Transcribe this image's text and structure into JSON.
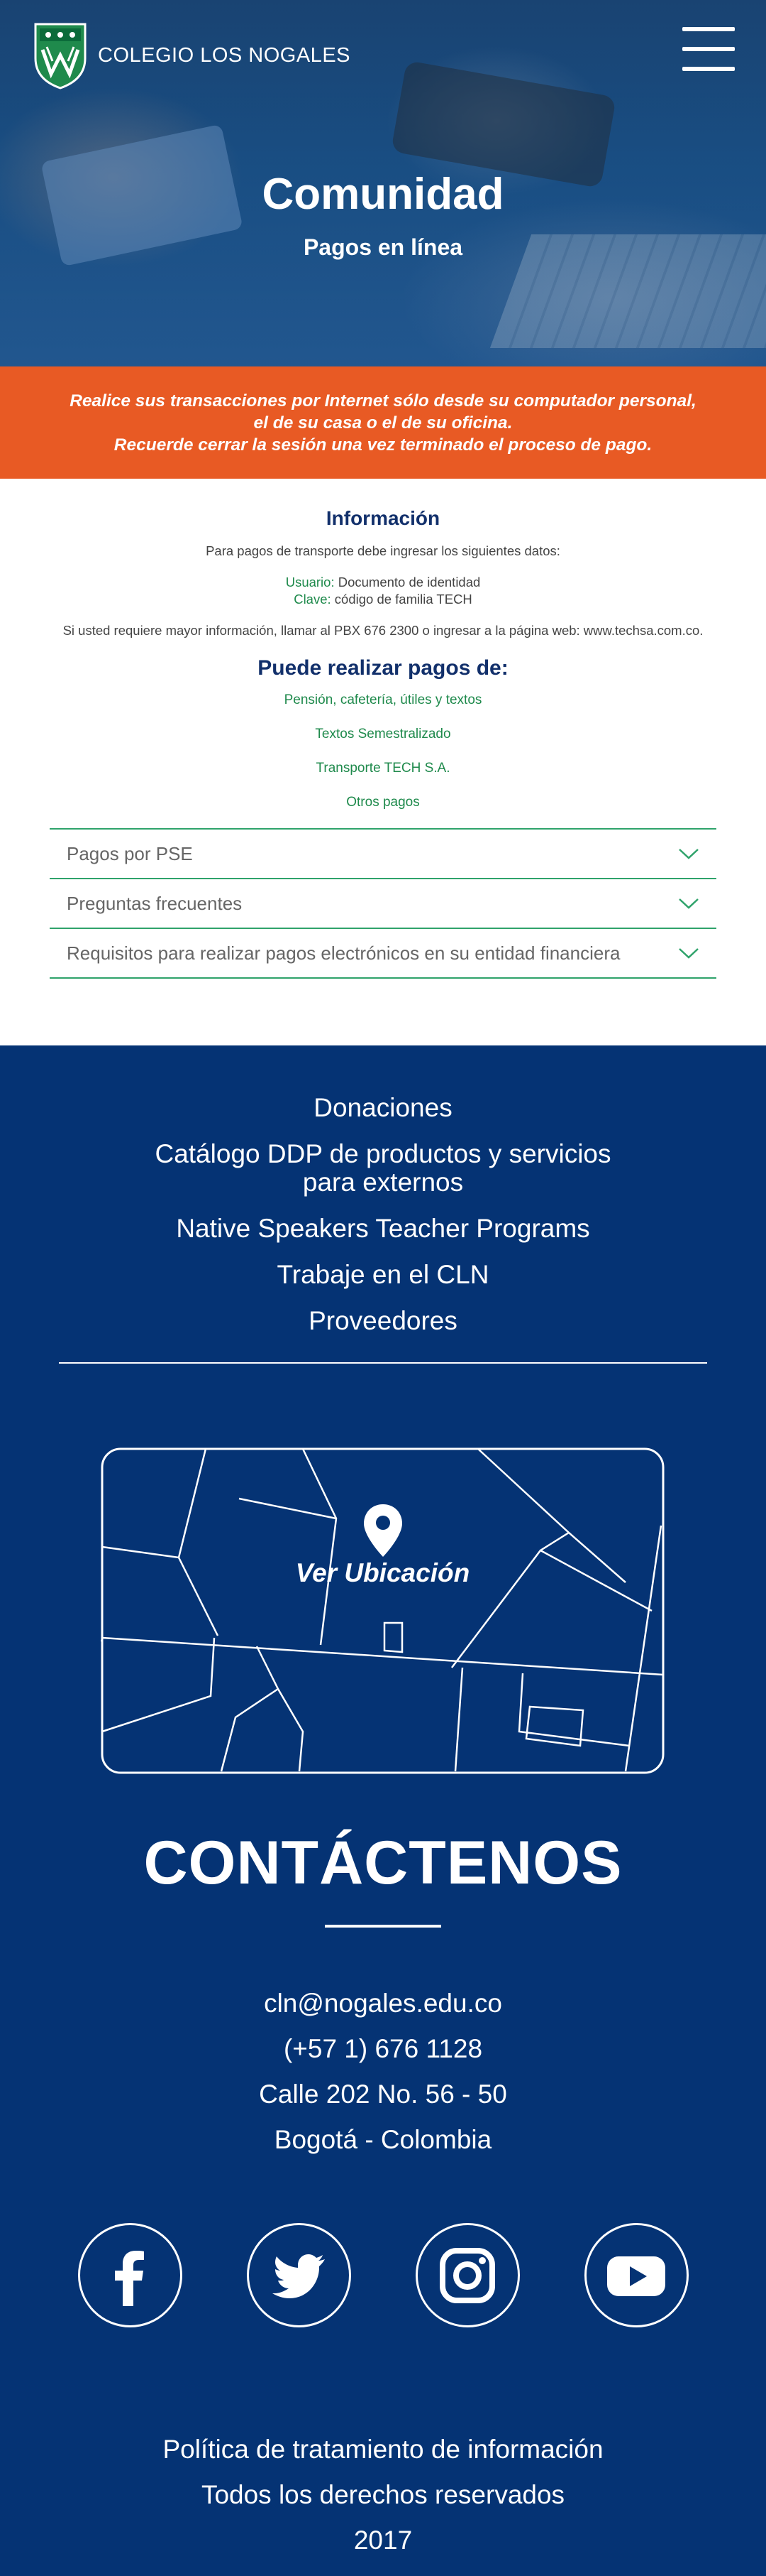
{
  "header": {
    "logo_text": "COLEGIO LOS NOGALES",
    "title": "Comunidad",
    "subtitle": "Pagos en línea"
  },
  "banner": {
    "line1": "Realice sus transacciones por Internet sólo desde su computador personal,",
    "line2": "el de su casa o el de su oficina.",
    "line3": "Recuerde cerrar la sesión una vez terminado el proceso de pago."
  },
  "info": {
    "title": "Información",
    "intro": "Para pagos de transporte debe ingresar los siguientes datos:",
    "user_label": "Usuario:",
    "user_value": "Documento de identidad",
    "key_label": "Clave:",
    "key_value": "código de familia TECH",
    "more": "Si usted requiere mayor información, llamar al PBX 676 2300 o ingresar a la página web: www.techsa.com.co."
  },
  "payments": {
    "title": "Puede realizar pagos de:",
    "items": [
      "Pensión, cafetería, útiles y textos",
      "Textos Semestralizado",
      "Transporte TECH S.A.",
      "Otros pagos"
    ]
  },
  "accordion": [
    "Pagos por PSE",
    "Preguntas frecuentes",
    "Requisitos para realizar pagos electrónicos en su entidad financiera"
  ],
  "footer": {
    "links": [
      "Donaciones",
      "Catálogo DDP de productos y servicios",
      "para externos",
      "Native Speakers Teacher Programs",
      "Trabaje en el CLN",
      "Proveedores"
    ],
    "map_label": "Ver Ubicación",
    "contact_title": "CONTÁCTENOS",
    "email": "cln@nogales.edu.co",
    "phone": "(+57 1) 676 1128",
    "address": "Calle 202 No. 56 - 50",
    "city": "Bogotá - Colombia",
    "socials": [
      "facebook-icon",
      "twitter-icon",
      "instagram-icon",
      "youtube-icon"
    ],
    "legal1": "Política de tratamiento de información",
    "legal2": "Todos los derechos reservados",
    "year": "2017"
  },
  "colors": {
    "navy": "#053374",
    "orange": "#e85a24",
    "green": "#1f8a4c",
    "title_blue": "#12306b"
  }
}
